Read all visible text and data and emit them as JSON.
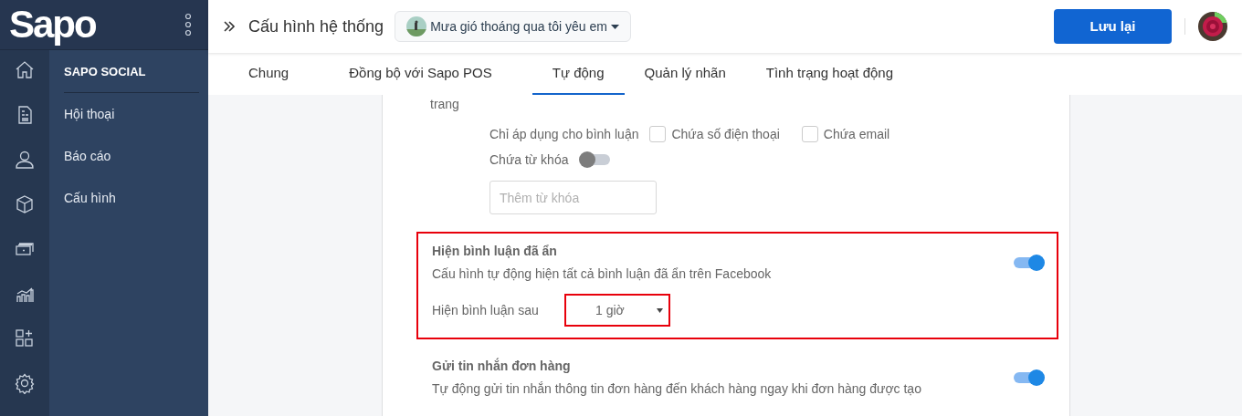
{
  "logo": "Sapo",
  "rail_icons": [
    {
      "kind": "home"
    },
    {
      "kind": "document"
    },
    {
      "kind": "user"
    },
    {
      "kind": "box"
    },
    {
      "kind": "money"
    },
    {
      "kind": "chart"
    },
    {
      "kind": "apps"
    },
    {
      "kind": "settings"
    }
  ],
  "sidebar": {
    "heading": "SAPO SOCIAL",
    "items": [
      "Hội thoại",
      "Báo cáo",
      "Cấu hình"
    ]
  },
  "header": {
    "title": "Cấu hình hệ thống",
    "page_selector": "Mưa gió thoáng qua tôi yêu em",
    "save_button": "Lưu lại"
  },
  "tabs": [
    {
      "label": "Chung",
      "selected": false
    },
    {
      "label": "Đồng bộ với Sapo POS",
      "selected": false
    },
    {
      "label": "Tự động",
      "selected": true
    },
    {
      "label": "Quản lý nhãn",
      "selected": false
    },
    {
      "label": "Tình trạng hoạt động",
      "selected": false
    }
  ],
  "cut_text": "trang",
  "filter": {
    "label": "Chỉ áp dụng cho bình luận",
    "options": [
      {
        "label": "Chứa số điện thoại",
        "checked": false
      },
      {
        "label": "Chứa email",
        "checked": false
      }
    ],
    "keyword_label": "Chứa từ khóa",
    "keyword_on": false,
    "keyword_placeholder": "Thêm từ khóa"
  },
  "sections": [
    {
      "title": "Hiện bình luận đã ẩn",
      "description": "Cấu hình tự động hiện tất cả bình luận đã ẩn trên Facebook",
      "on": true,
      "highlighted": true,
      "setting_label": "Hiện bình luận sau",
      "setting_value": "1 giờ",
      "setting_highlighted": true
    },
    {
      "title": "Gửi tin nhắn đơn hàng",
      "description": "Tự động gửi tin nhắn thông tin đơn hàng đến khách hàng ngay khi đơn hàng được tạo",
      "on": true,
      "highlighted": false
    }
  ]
}
